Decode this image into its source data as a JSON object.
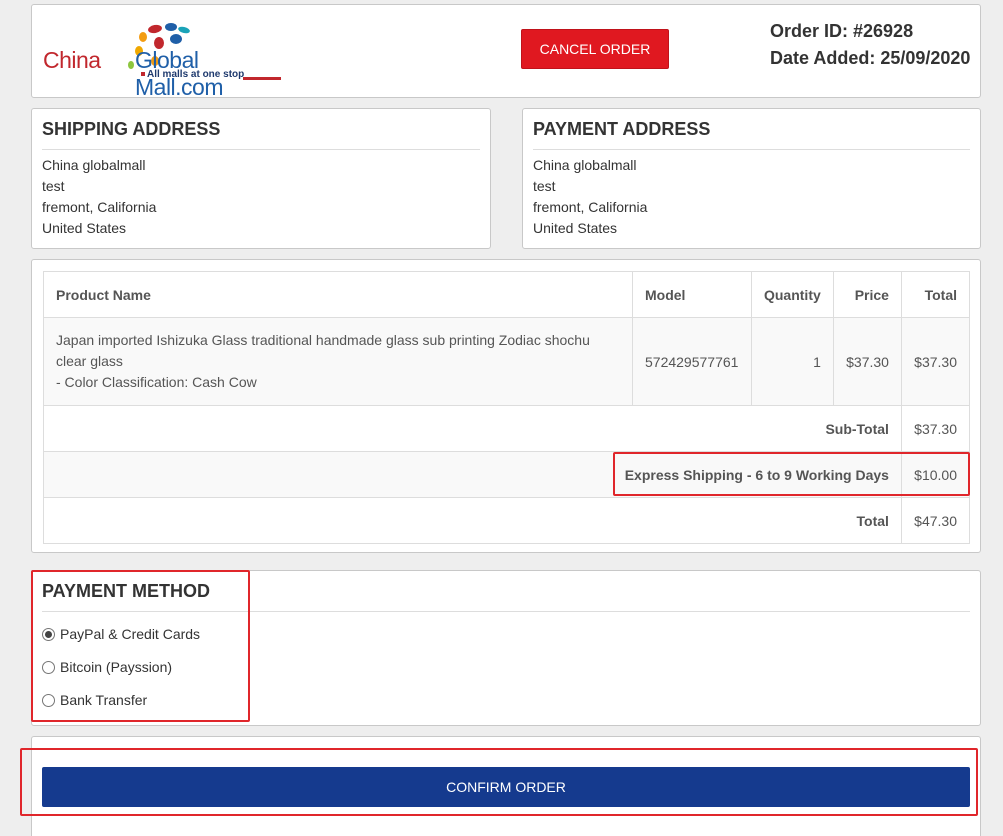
{
  "header": {
    "logo": {
      "part1": "China",
      "part2": "Global Mall.com",
      "tagline": "All malls at one stop"
    },
    "cancel_label": "CANCEL ORDER",
    "order_id": "Order ID: #26928",
    "date_added": "Date Added: 25/09/2020"
  },
  "shipping_address": {
    "title": "SHIPPING ADDRESS",
    "lines": [
      "China globalmall",
      "test",
      "fremont, California",
      "United States"
    ]
  },
  "payment_address": {
    "title": "PAYMENT ADDRESS",
    "lines": [
      "China globalmall",
      "test",
      "fremont, California",
      "United States"
    ]
  },
  "products": {
    "headers": [
      "Product Name",
      "Model",
      "Quantity",
      "Price",
      "Total"
    ],
    "items": [
      {
        "name": "Japan imported Ishizuka Glass traditional handmade glass sub printing Zodiac shochu clear glass",
        "option": "- Color Classification: Cash Cow",
        "model": "572429577761",
        "quantity": "1",
        "price": "$37.30",
        "total": "$37.30"
      }
    ],
    "totals": [
      {
        "label": "Sub-Total",
        "value": "$37.30"
      },
      {
        "label": "Express Shipping - 6 to 9 Working Days",
        "value": "$10.00"
      },
      {
        "label": "Total",
        "value": "$47.30"
      }
    ]
  },
  "payment_method": {
    "title": "PAYMENT METHOD",
    "options": [
      "PayPal & Credit Cards",
      "Bitcoin (Payssion)",
      "Bank Transfer"
    ],
    "selected": "PayPal & Credit Cards"
  },
  "confirm_label": "CONFIRM ORDER",
  "colors": {
    "cancel": "#e01820",
    "confirm": "#153a8e",
    "highlight": "#e0262b"
  }
}
